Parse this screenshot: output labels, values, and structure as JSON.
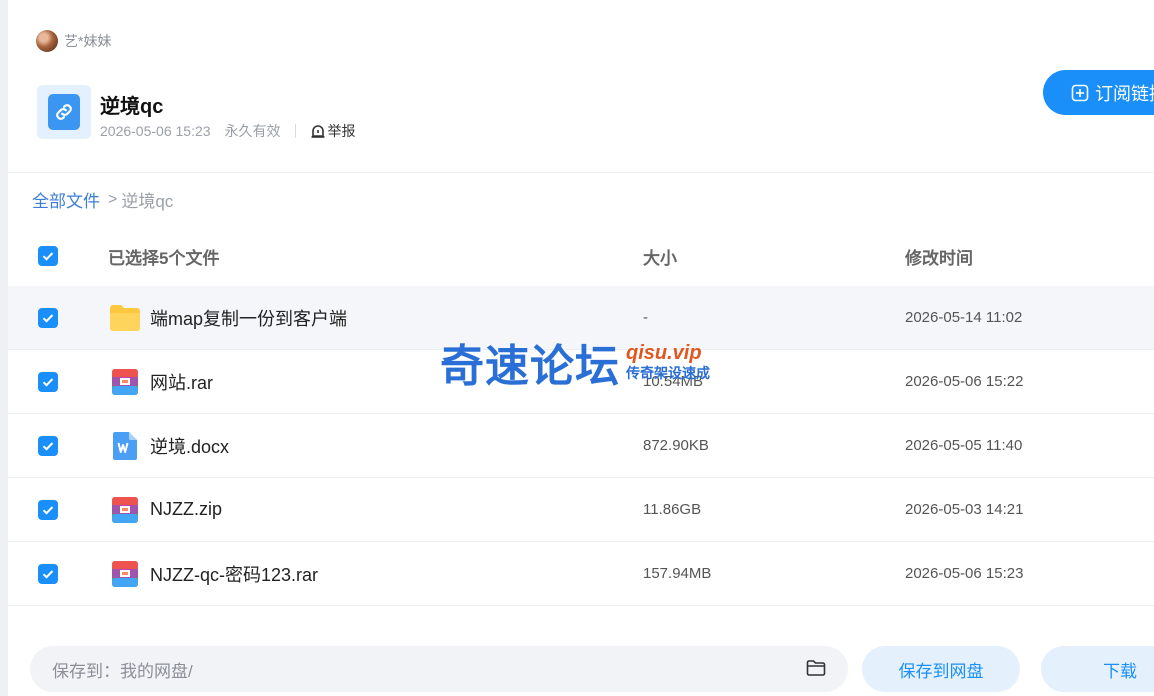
{
  "owner": {
    "name": "艺*妹妹"
  },
  "share": {
    "title": "逆境qc",
    "date": "2026-05-06 15:23",
    "validity": "永久有效",
    "report_label": "举报"
  },
  "subscribe_label": "订阅链接",
  "breadcrumb": {
    "root": "全部文件",
    "sep": ">",
    "current": "逆境qc"
  },
  "table": {
    "header": {
      "name": "已选择5个文件",
      "size": "大小",
      "time": "修改时间"
    },
    "rows": [
      {
        "icon": "folder-icon",
        "name": "端map复制一份到客户端",
        "size": "-",
        "time": "2026-05-14 11:02"
      },
      {
        "icon": "archive-icon",
        "name": "网站.rar",
        "size": "10.54MB",
        "time": "2026-05-06 15:22"
      },
      {
        "icon": "word-doc-icon",
        "name": "逆境.docx",
        "size": "872.90KB",
        "time": "2026-05-05 11:40"
      },
      {
        "icon": "archive-icon",
        "name": "NJZZ.zip",
        "size": "11.86GB",
        "time": "2026-05-03 14:21"
      },
      {
        "icon": "archive-icon",
        "name": "NJZZ-qc-密码123.rar",
        "size": "157.94MB",
        "time": "2026-05-06 15:23"
      }
    ]
  },
  "watermark": {
    "main": "奇速论坛",
    "url": "qisu.vip",
    "slogan": "传奇架设速成"
  },
  "bottom": {
    "save_path": "保存到：我的网盘/",
    "save_label": "保存到网盘",
    "download_label": "下载"
  },
  "colors": {
    "accent": "#1a8ffa",
    "link": "#3b7ed8",
    "folder": "#ffc840"
  }
}
